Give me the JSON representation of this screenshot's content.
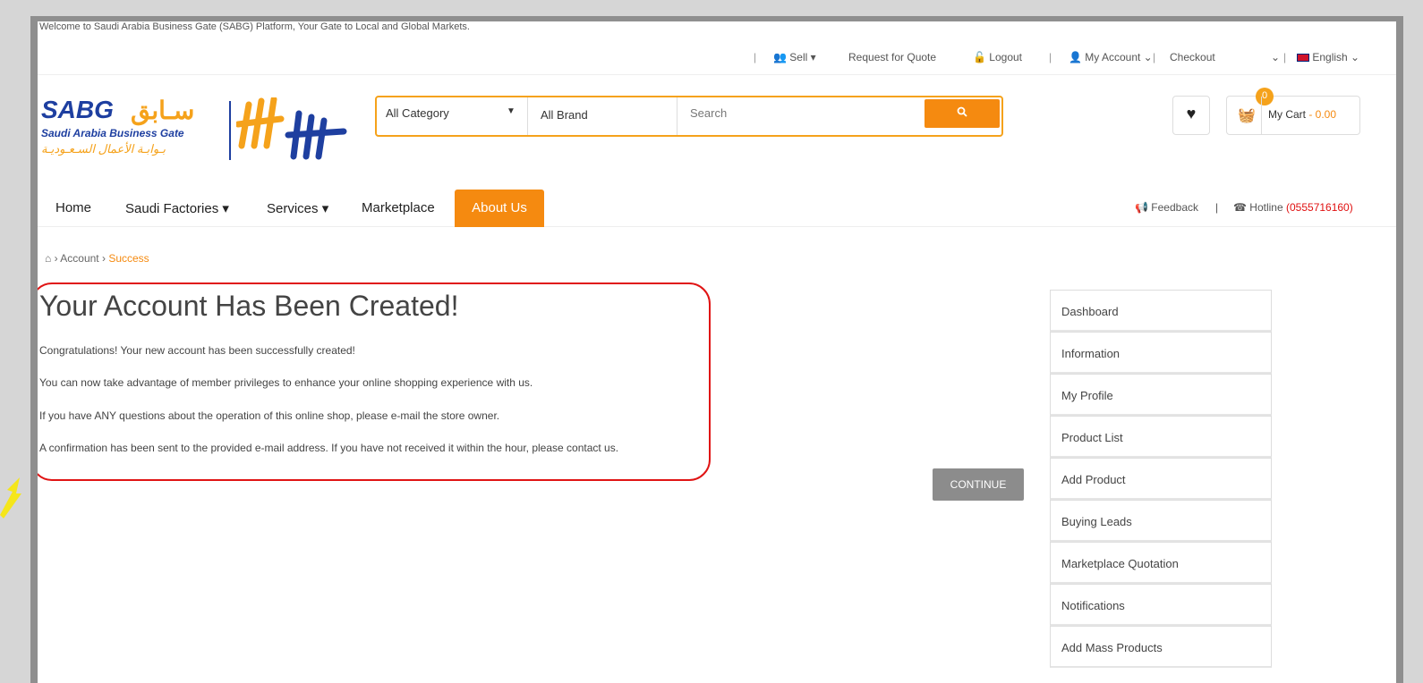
{
  "welcome": "Welcome to Saudi Arabia Business Gate (SABG) Platform, Your Gate to Local and Global Markets.",
  "topbar": {
    "sell": "Sell",
    "rfq": "Request for Quote",
    "logout": "Logout",
    "account": "My Account",
    "checkout": "Checkout",
    "language": "English"
  },
  "logo": {
    "latin": "SABG",
    "arabic": "سـابق",
    "line1": "Saudi Arabia Business Gate",
    "line2": "بـوابـة الأعمال السـعـوديـة"
  },
  "search": {
    "category": "All Category",
    "brand": "All Brand",
    "placeholder": "Search"
  },
  "cart": {
    "count": "0",
    "label": "My Cart",
    "amount": "- 0.00"
  },
  "nav": {
    "items": [
      "Home",
      "Saudi Factories",
      "Services",
      "Marketplace",
      "About Us"
    ],
    "feedback": "Feedback",
    "hotline_label": "Hotline",
    "hotline_number": "(0555716160)"
  },
  "breadcrumb": {
    "account": "Account",
    "current": "Success"
  },
  "content": {
    "title": "Your Account Has Been Created!",
    "paragraphs": [
      "Congratulations! Your new account has been successfully created!",
      "You can now take advantage of member privileges to enhance your online shopping experience with us.",
      "If you have ANY questions about the operation of this online shop, please e-mail the store owner.",
      "A confirmation has been sent to the provided e-mail address. If you have not received it within the hour, please contact us."
    ],
    "continue": "CONTINUE"
  },
  "sidebar": {
    "items": [
      "Dashboard",
      "Information",
      "My Profile",
      "Product List",
      "Add Product",
      "Buying Leads",
      "Marketplace Quotation",
      "Notifications",
      "Add Mass Products"
    ]
  },
  "colors": {
    "accent": "#f58a10",
    "brand_blue": "#1e3fa0",
    "highlight": "#e01414",
    "annotation_arrow": "#f5e61b"
  }
}
